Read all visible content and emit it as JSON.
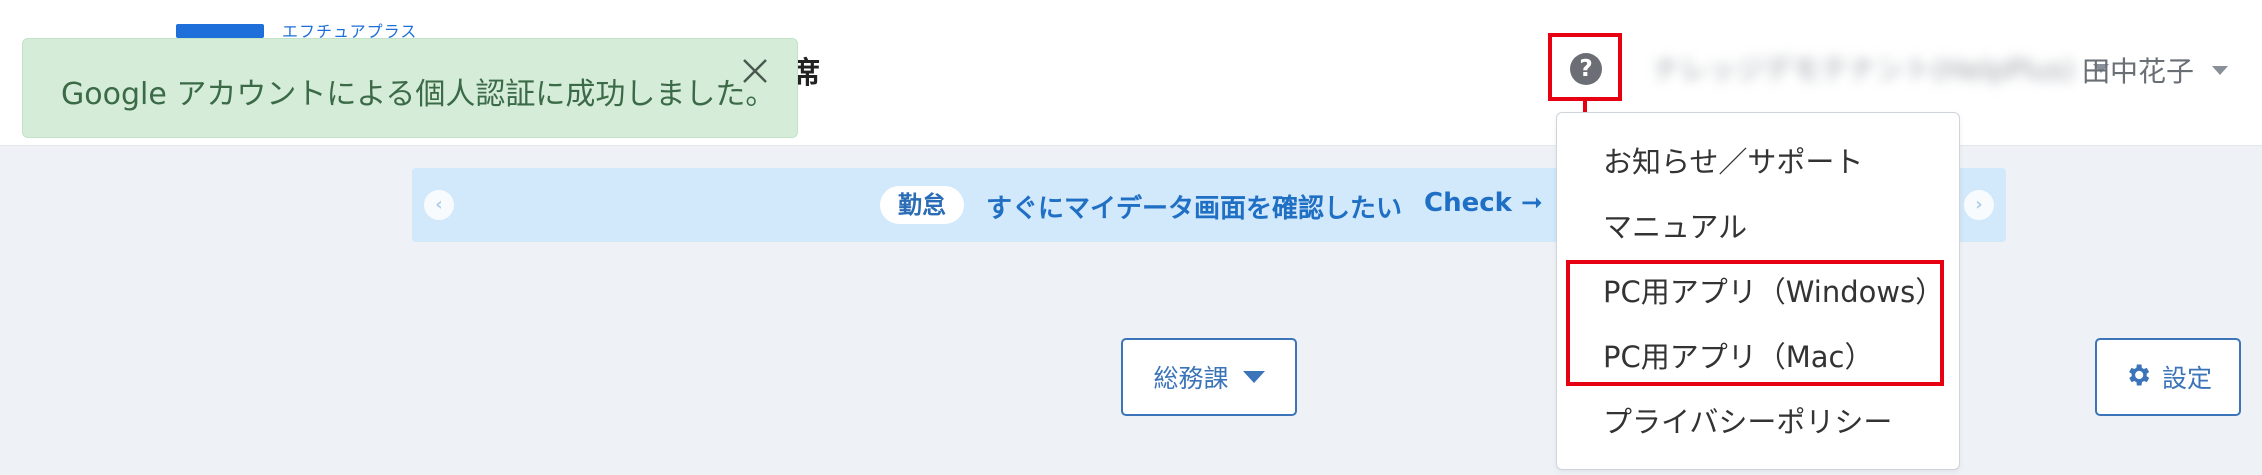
{
  "header": {
    "toast_message": "Google アカウントによる個人認証に成功しました。",
    "title_tail": "席",
    "logo_sub": "エフチュアプラス",
    "help_label": "?",
    "company_name": "ナレッジデモテナント(HelpPlus)",
    "user_name": "田中花子"
  },
  "banner": {
    "prev": "‹",
    "next": "›",
    "tag": "勤怠",
    "message": "すぐにマイデータ画面を確認したい",
    "check": "Check ➞"
  },
  "controls": {
    "department": "総務課",
    "settings": "設定"
  },
  "help_menu": {
    "items": [
      "お知らせ／サポート",
      "マニュアル",
      "PC用アプリ（Windows）",
      "PC用アプリ（Mac）",
      "プライバシーポリシー"
    ]
  },
  "colors": {
    "accent": "#3b74b8",
    "annotation_red": "#e60012",
    "toast_bg": "#d5ecd9",
    "banner_bg": "#d2e8fb"
  }
}
